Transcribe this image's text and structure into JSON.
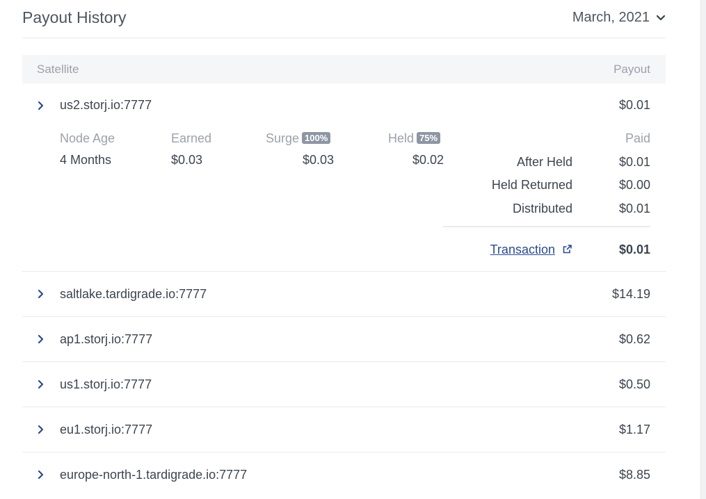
{
  "header": {
    "title": "Payout History",
    "period": "March, 2021"
  },
  "table": {
    "col_satellite": "Satellite",
    "col_payout": "Payout"
  },
  "expanded": {
    "name": "us2.storj.io:7777",
    "payout": "$0.01",
    "labels": {
      "node_age": "Node Age",
      "earned": "Earned",
      "surge": "Surge",
      "surge_badge": "100%",
      "held": "Held",
      "held_badge": "75%",
      "paid": "Paid"
    },
    "values": {
      "node_age": "4 Months",
      "earned": "$0.03",
      "surge": "$0.03",
      "held": "$0.02"
    },
    "paid_rows": [
      {
        "label": "After Held",
        "value": "$0.01"
      },
      {
        "label": "Held Returned",
        "value": "$0.00"
      },
      {
        "label": "Distributed",
        "value": "$0.01"
      }
    ],
    "transaction_label": "Transaction",
    "total": "$0.01"
  },
  "rows": [
    {
      "name": "saltlake.tardigrade.io:7777",
      "payout": "$14.19"
    },
    {
      "name": "ap1.storj.io:7777",
      "payout": "$0.62"
    },
    {
      "name": "us1.storj.io:7777",
      "payout": "$0.50"
    },
    {
      "name": "eu1.storj.io:7777",
      "payout": "$1.17"
    },
    {
      "name": "europe-north-1.tardigrade.io:7777",
      "payout": "$8.85"
    }
  ],
  "colors": {
    "accent": "#2a4b8d",
    "badge": "#8e96a3",
    "muted": "#9ca1aa"
  }
}
